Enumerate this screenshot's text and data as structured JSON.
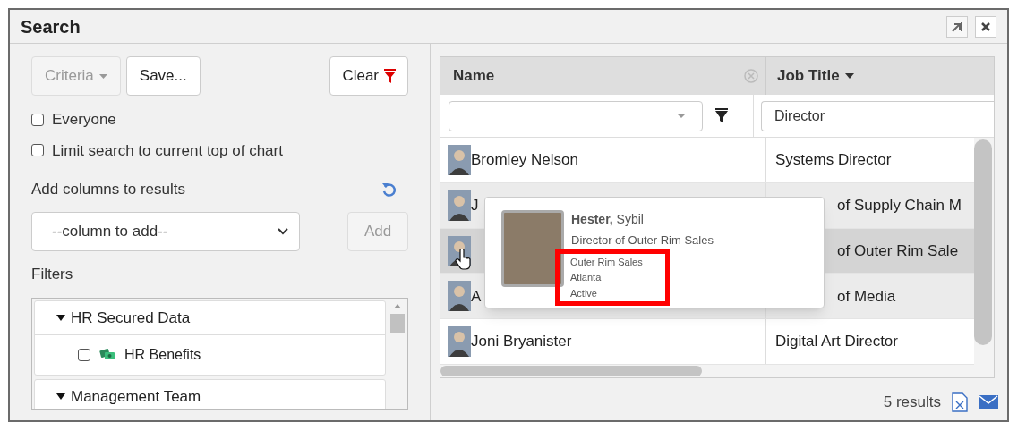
{
  "window": {
    "title": "Search"
  },
  "left": {
    "criteria_button": {
      "label": "Criteria",
      "disabled": true
    },
    "save_button": "Save...",
    "clear_button": "Clear",
    "options": [
      {
        "label": "Everyone",
        "checked": false
      },
      {
        "label": "Limit search to current top of chart",
        "checked": false
      }
    ],
    "add_columns_label": "Add columns to results",
    "column_select": {
      "value": "--column to add--"
    },
    "add_button": {
      "label": "Add",
      "disabled": true
    },
    "filters_label": "Filters",
    "filters": [
      {
        "label": "HR Secured Data",
        "expanded": true,
        "children": [
          {
            "label": "HR Benefits",
            "checked": false
          }
        ]
      },
      {
        "label": "Management Team",
        "expanded": true
      }
    ]
  },
  "table": {
    "columns": [
      {
        "label": "Name"
      },
      {
        "label": "Job Title"
      }
    ],
    "job_filter": {
      "value": "Director"
    },
    "rows": [
      {
        "name": "Bromley Nelson",
        "job_title": "Systems Director",
        "hovered": false,
        "covered": false
      },
      {
        "name": "J",
        "job_title": "of Supply Chain M",
        "hovered": false,
        "covered": true
      },
      {
        "job_title": "of Outer Rim Sale",
        "hovered": true,
        "covered": true
      },
      {
        "name": "A",
        "job_title": "of Media",
        "hovered": false,
        "covered": true
      },
      {
        "name": "Joni Bryanister",
        "job_title": "Digital Art Director",
        "hovered": false,
        "covered": false
      }
    ]
  },
  "tooltip": {
    "name": "**Hester,** Sybil",
    "title": "Director of Outer Rim Sales",
    "details": [
      "Outer Rim Sales",
      "Atlanta",
      "Active"
    ]
  },
  "footer": {
    "count": "5 results"
  }
}
